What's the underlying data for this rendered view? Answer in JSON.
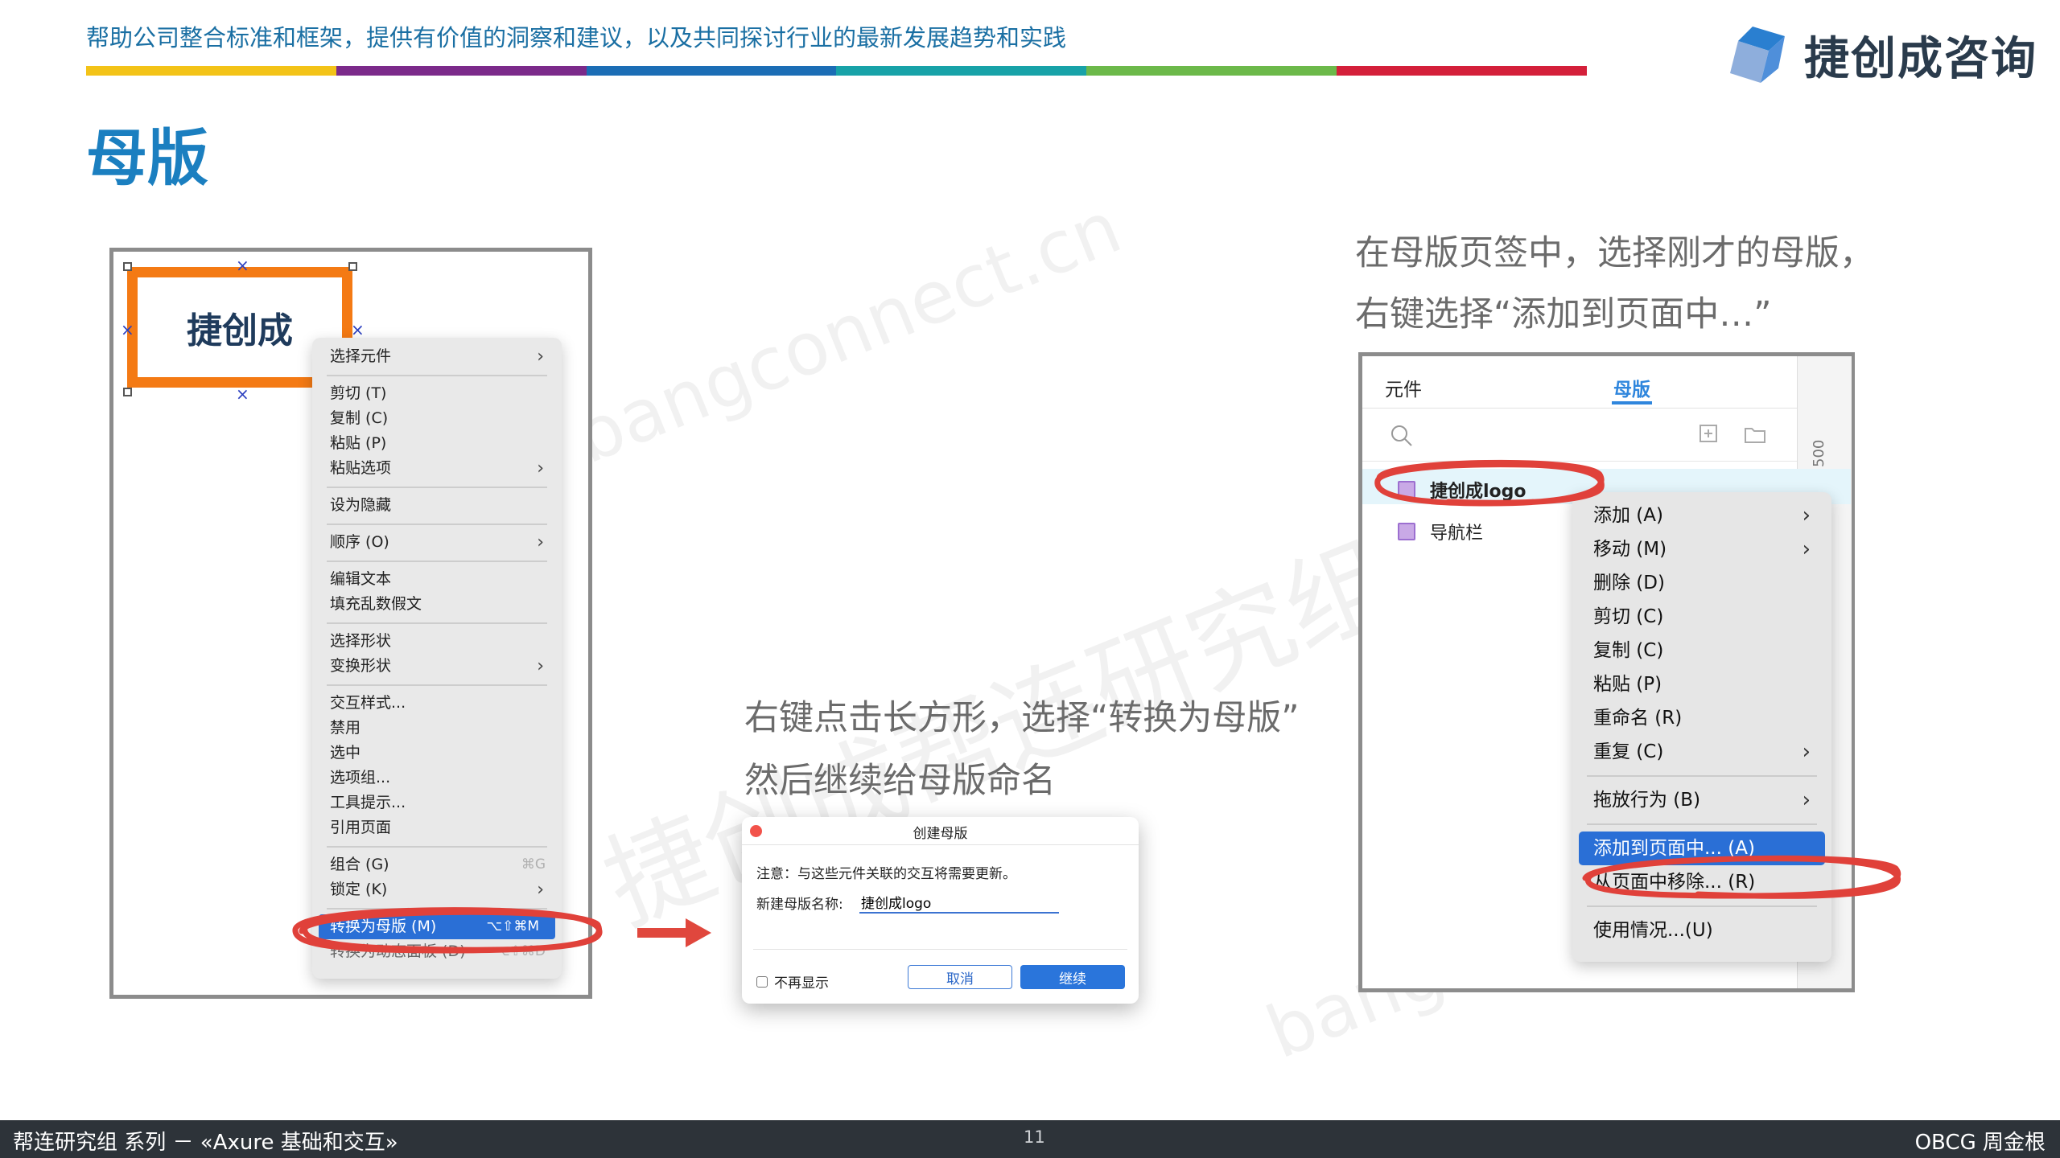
{
  "header": {
    "tagline": "帮助公司整合标准和框架，提供有价值的洞察和建议，以及共同探讨行业的最新发展趋势和实践",
    "brand_name": "捷创成咨询",
    "colorbar": [
      "#f3c318",
      "#7b2a8a",
      "#1b6db5",
      "#18a2a8",
      "#6cb94a",
      "#d4203a"
    ]
  },
  "page_title": "母版",
  "watermarks": [
    "bangconnect.cn",
    "捷创成帮连研究组 OBCG",
    "bangconnect.cn"
  ],
  "left_panel": {
    "widget_text": "捷创成",
    "context_menu": [
      {
        "label": "选择元件",
        "arrow": "›"
      },
      {
        "sep": true
      },
      {
        "label": "剪切 (T)"
      },
      {
        "label": "复制 (C)"
      },
      {
        "label": "粘贴 (P)"
      },
      {
        "label": "粘贴选项",
        "arrow": "›"
      },
      {
        "sep": true
      },
      {
        "label": "设为隐藏"
      },
      {
        "sep": true
      },
      {
        "label": "顺序 (O)",
        "arrow": "›"
      },
      {
        "sep": true
      },
      {
        "label": "编辑文本"
      },
      {
        "label": "填充乱数假文"
      },
      {
        "sep": true
      },
      {
        "label": "选择形状"
      },
      {
        "label": "变换形状",
        "arrow": "›"
      },
      {
        "sep": true
      },
      {
        "label": "交互样式..."
      },
      {
        "label": "禁用"
      },
      {
        "label": "选中"
      },
      {
        "label": "选项组..."
      },
      {
        "label": "工具提示..."
      },
      {
        "label": "引用页面"
      },
      {
        "sep": true
      },
      {
        "label": "组合 (G)",
        "shortcut": "⌘G"
      },
      {
        "label": "锁定 (K)",
        "arrow": "›"
      },
      {
        "sep": true
      },
      {
        "label": "转换为母版 (M)",
        "shortcut": "⌥⇧⌘M",
        "highlight": true
      },
      {
        "label": "转换为动态面板 (D)",
        "shortcut": "⌥⇧⌘D",
        "faded": true
      }
    ]
  },
  "middle_caption": {
    "line1": "右键点击长方形，选择“转换为母版”",
    "line2": "然后继续给母版命名"
  },
  "dialog": {
    "title": "创建母版",
    "note": "注意：与这些元件关联的交互将需要更新。",
    "name_label": "新建母版名称:",
    "name_value": "捷创成logo",
    "dont_show": "不再显示",
    "cancel": "取消",
    "continue": "继续"
  },
  "right_caption": {
    "line1": "在母版页签中，选择刚才的母版，",
    "line2": "右键选择“添加到页面中…”"
  },
  "right_panel": {
    "tab_widgets": "元件",
    "tab_masters": "母版",
    "ruler_number": "500",
    "items": [
      "捷创成logo",
      "导航栏"
    ],
    "context_menu": [
      {
        "label": "添加 (A)",
        "arrow": "›"
      },
      {
        "label": "移动 (M)",
        "arrow": "›"
      },
      {
        "label": "删除 (D)"
      },
      {
        "label": "剪切 (C)"
      },
      {
        "label": "复制 (C)"
      },
      {
        "label": "粘贴 (P)"
      },
      {
        "label": "重命名 (R)"
      },
      {
        "label": "重复 (C)",
        "arrow": "›"
      },
      {
        "sep": true
      },
      {
        "label": "拖放行为 (B)",
        "arrow": "›"
      },
      {
        "sep": true
      },
      {
        "label": "添加到页面中... (A)",
        "highlight": true
      },
      {
        "label": "从页面中移除... (R)"
      },
      {
        "sep": true
      },
      {
        "label": "使用情况...(U)"
      }
    ]
  },
  "footer": {
    "left": "帮连研究组 系列 － «Axure 基础和交互»",
    "page_number": "11",
    "right": "OBCG 周金根"
  }
}
